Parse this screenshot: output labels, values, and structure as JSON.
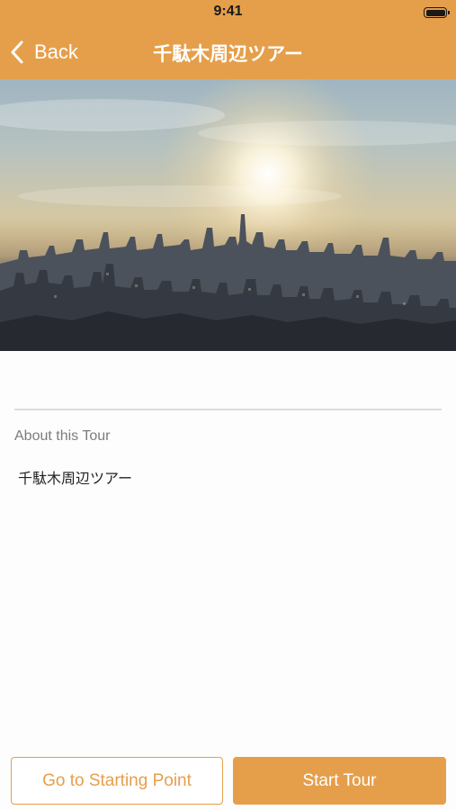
{
  "status_bar": {
    "time": "9:41"
  },
  "nav": {
    "back_label": "Back",
    "title": "千駄木周辺ツアー"
  },
  "hero": {
    "image": "city-skyline-photo"
  },
  "about": {
    "label": "About this Tour",
    "text": "千駄木周辺ツアー"
  },
  "actions": {
    "start_point_label": "Go to Starting Point",
    "start_tour_label": "Start Tour"
  },
  "colors": {
    "accent": "#e59f4b",
    "label": "#7c7c7c"
  }
}
